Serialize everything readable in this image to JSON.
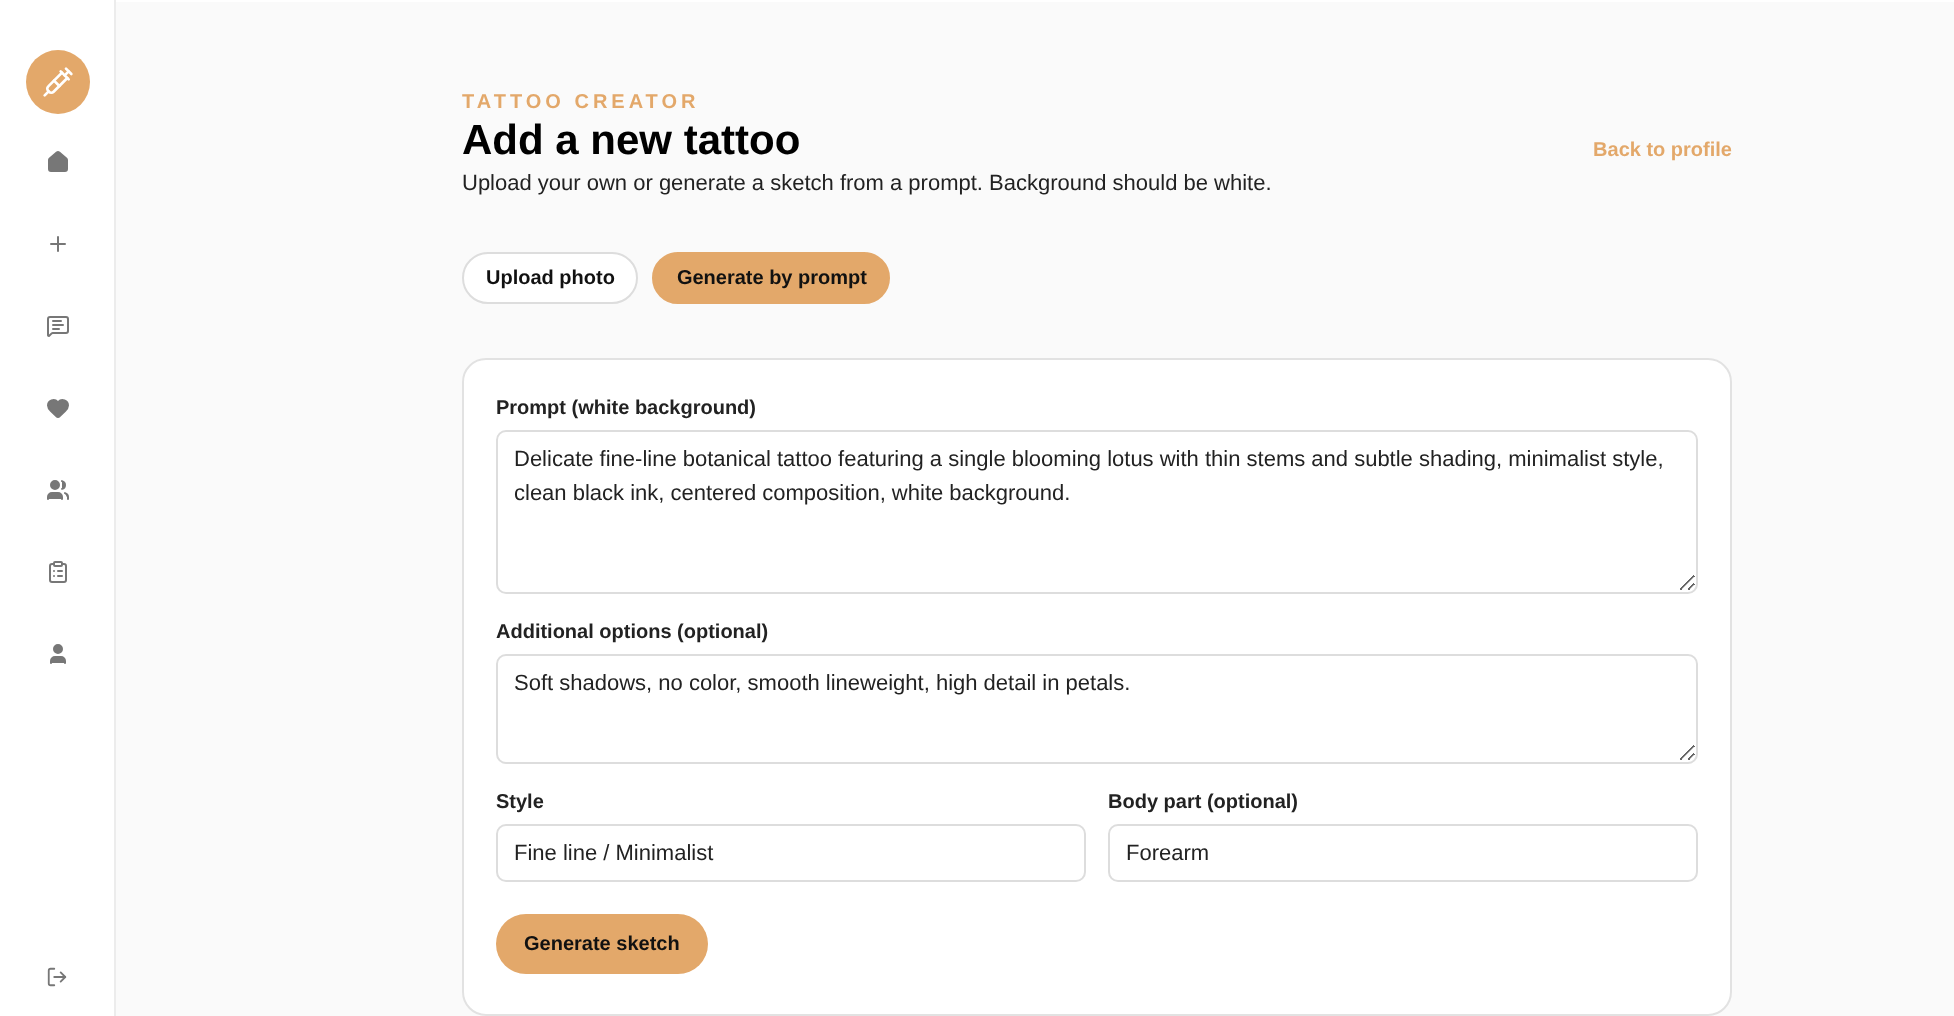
{
  "header": {
    "kicker": "TATTOO CREATOR",
    "title": "Add a new tattoo",
    "subtitle": "Upload your own or generate a sketch from a prompt. Background should be white.",
    "back_link": "Back to profile"
  },
  "modes": [
    {
      "label": "Upload photo",
      "selected": false
    },
    {
      "label": "Generate by prompt",
      "selected": true
    }
  ],
  "form": {
    "prompt": {
      "label": "Prompt (white background)",
      "value": "Delicate fine-line botanical tattoo featuring a single blooming lotus with thin stems and subtle shading, minimalist style, clean black ink, centered composition, white background."
    },
    "options": {
      "label": "Additional options (optional)",
      "value": "Soft shadows, no color, smooth lineweight, high detail in petals."
    },
    "style": {
      "label": "Style",
      "value": "Fine line / Minimalist"
    },
    "body_part": {
      "label": "Body part (optional)",
      "value": "Forearm"
    },
    "submit": "Generate sketch"
  }
}
